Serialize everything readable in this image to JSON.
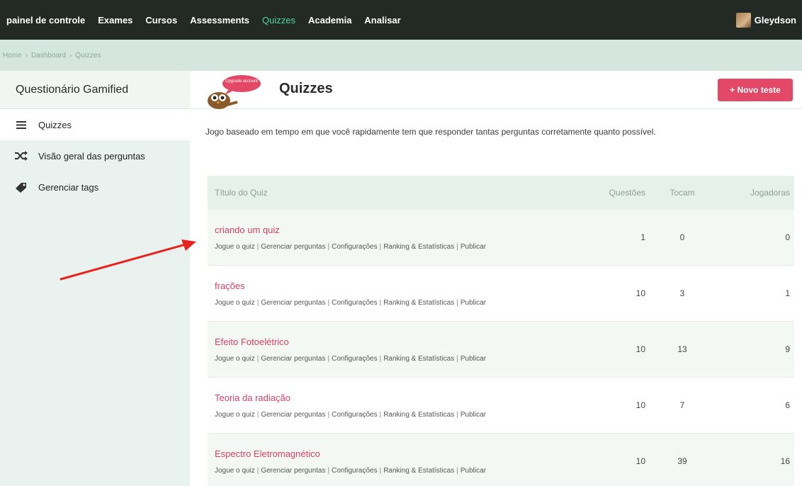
{
  "topnav": {
    "items": [
      "painel de controle",
      "Exames",
      "Cursos",
      "Assessments",
      "Quizzes",
      "Academia",
      "Analisar"
    ],
    "user_name": "Gleydson"
  },
  "breadcrumb": [
    "Home",
    "Dashboard",
    "Quizzes"
  ],
  "sidebar": {
    "title": "Questionário Gamified",
    "items": [
      {
        "label": "Quizzes",
        "icon": "menu-icon"
      },
      {
        "label": "Visão geral das perguntas",
        "icon": "shuffle-icon"
      },
      {
        "label": "Gerenciar tags",
        "icon": "tag-icon"
      }
    ]
  },
  "main": {
    "badge_text": "Upgrade account",
    "title": "Quizzes",
    "new_button": "+ Novo teste",
    "description": "Jogo baseado em tempo em que você rapidamente tem que responder tantas perguntas corretamente quanto possível."
  },
  "table": {
    "headers": [
      "Título do Quiz",
      "Questões",
      "Tocam",
      "Jogadoras"
    ],
    "actions": [
      "Jogue o quiz",
      "Gerenciar perguntas",
      "Configurações",
      "Ranking & Estatísticas",
      "Publicar"
    ],
    "rows": [
      {
        "title": "criando um quiz",
        "questions": "1",
        "plays": "0",
        "players": "0"
      },
      {
        "title": "frações",
        "questions": "10",
        "plays": "3",
        "players": "1"
      },
      {
        "title": "Efeito Fotoelétrico",
        "questions": "10",
        "plays": "13",
        "players": "9"
      },
      {
        "title": "Teoria da radiação",
        "questions": "10",
        "plays": "7",
        "players": "6"
      },
      {
        "title": "Espectro Eletromagnético",
        "questions": "10",
        "plays": "39",
        "players": "16"
      }
    ]
  },
  "colors": {
    "topbar": "#232a26",
    "active_nav": "#4bd6a0",
    "accent": "#e44867",
    "quiz_link": "#d64265",
    "annotation_arrow": "#e8231d"
  }
}
